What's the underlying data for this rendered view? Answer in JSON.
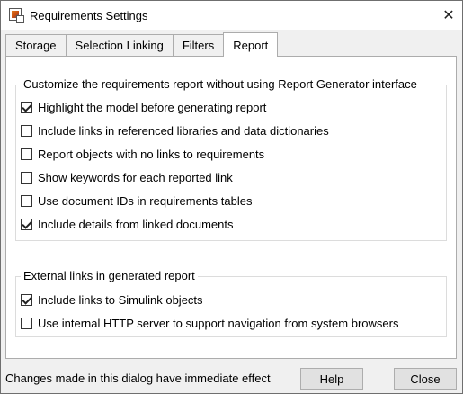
{
  "window": {
    "title": "Requirements Settings",
    "close_glyph": "✕"
  },
  "tabs": [
    {
      "label": "Storage"
    },
    {
      "label": "Selection Linking"
    },
    {
      "label": "Filters"
    },
    {
      "label": "Report"
    }
  ],
  "report_group": {
    "title": "Customize the requirements report without using Report Generator interface",
    "options": [
      {
        "label": "Highlight the model before generating report",
        "checked": true
      },
      {
        "label": "Include links in referenced libraries and data dictionaries",
        "checked": false
      },
      {
        "label": "Report objects with no links to requirements",
        "checked": false
      },
      {
        "label": "Show keywords for each reported link",
        "checked": false
      },
      {
        "label": "Use document IDs in requirements tables",
        "checked": false
      },
      {
        "label": "Include details from linked documents",
        "checked": true
      }
    ]
  },
  "external_group": {
    "title": "External links in generated report",
    "options": [
      {
        "label": "Include links to Simulink objects",
        "checked": true
      },
      {
        "label": "Use internal HTTP server to support navigation from system browsers",
        "checked": false
      }
    ]
  },
  "status": {
    "text": "Changes made in this dialog have immediate effect",
    "help_label": "Help",
    "close_label": "Close"
  }
}
